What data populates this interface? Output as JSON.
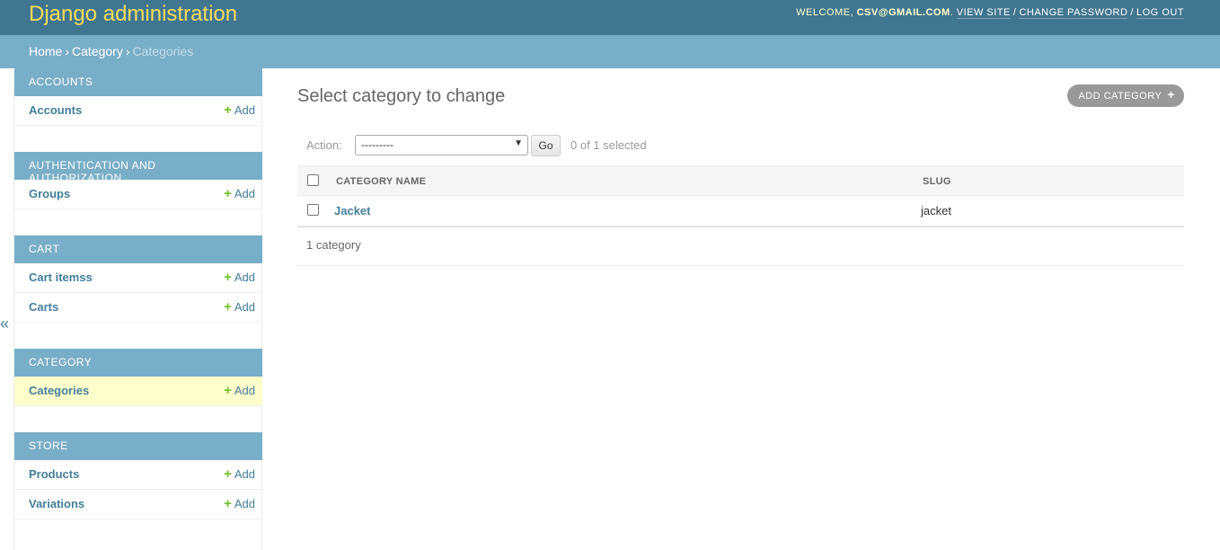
{
  "header": {
    "branding": "Django administration",
    "welcome": "WELCOME, ",
    "user": "CSV@GMAIL.COM",
    "view_site": "VIEW SITE",
    "change_password": "CHANGE PASSWORD",
    "log_out": "LOG OUT"
  },
  "breadcrumbs": {
    "home": "Home",
    "app": "Category",
    "current": "Categories"
  },
  "sidebar": {
    "toggle": "«",
    "modules": [
      {
        "caption": "ACCOUNTS",
        "models": [
          {
            "name": "Accounts",
            "add": "Add"
          }
        ]
      },
      {
        "caption": "AUTHENTICATION AND AUTHORIZATION",
        "models": [
          {
            "name": "Groups",
            "add": "Add"
          }
        ]
      },
      {
        "caption": "CART",
        "models": [
          {
            "name": "Cart itemss",
            "add": "Add"
          },
          {
            "name": "Carts",
            "add": "Add"
          }
        ]
      },
      {
        "caption": "CATEGORY",
        "models": [
          {
            "name": "Categories",
            "add": "Add"
          }
        ]
      },
      {
        "caption": "STORE",
        "models": [
          {
            "name": "Products",
            "add": "Add"
          },
          {
            "name": "Variations",
            "add": "Add"
          }
        ]
      }
    ]
  },
  "content": {
    "title": "Select category to change",
    "add_button": "ADD CATEGORY",
    "action_label": "Action:",
    "action_selected": "---------",
    "go_label": "Go",
    "selection_count": "0 of 1 selected",
    "columns": [
      "CATEGORY NAME",
      "SLUG"
    ],
    "rows": [
      {
        "category_name": "Jacket",
        "slug": "jacket"
      }
    ],
    "paginator": "1 category"
  },
  "colors": {
    "header_bg": "#417690",
    "branding": "#f5dd5d",
    "breadcrumbs_bg": "#79aec8",
    "module_caption_bg": "#79aec8",
    "link": "#447e9b",
    "add_plus": "#70bf2b",
    "current_row_bg": "#ffffcc"
  }
}
